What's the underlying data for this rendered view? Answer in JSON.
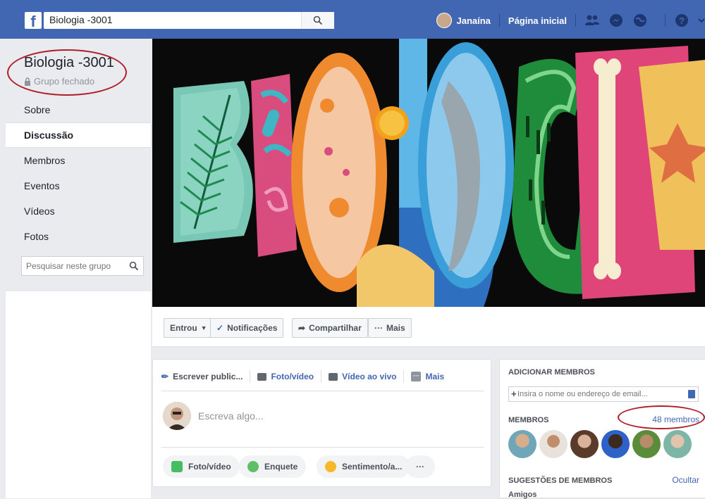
{
  "topbar": {
    "logo": "f",
    "search_value": "Biologia -3001",
    "user_name": "Janaína",
    "home_label": "Página inicial"
  },
  "group": {
    "title": "Biologia -3001",
    "type": "Grupo fechado"
  },
  "nav": {
    "items": [
      {
        "label": "Sobre"
      },
      {
        "label": "Discussão"
      },
      {
        "label": "Membros"
      },
      {
        "label": "Eventos"
      },
      {
        "label": "Vídeos"
      },
      {
        "label": "Fotos"
      }
    ],
    "active_index": 1,
    "search_placeholder": "Pesquisar neste grupo"
  },
  "actions": {
    "joined": "Entrou",
    "notifications": "Notificações",
    "share": "Compartilhar",
    "more": "Mais"
  },
  "composer": {
    "tabs": [
      "Escrever public...",
      "Foto/vídeo",
      "Vídeo ao vivo",
      "Mais"
    ],
    "placeholder": "Escreva algo...",
    "buttons": [
      "Foto/vídeo",
      "Enquete",
      "Sentimento/a...",
      "···"
    ]
  },
  "right": {
    "add_members_title": "ADICIONAR MEMBROS",
    "add_members_placeholder": "Insira o nome ou endereço de email...",
    "members_title": "MEMBROS",
    "members_count": "48 membros",
    "suggestions_title": "SUGESTÕES DE MEMBROS",
    "hide_label": "Ocultar",
    "friends_label": "Amigos"
  },
  "colors": {
    "brand": "#4267b2",
    "annotation": "#b01e2c"
  }
}
